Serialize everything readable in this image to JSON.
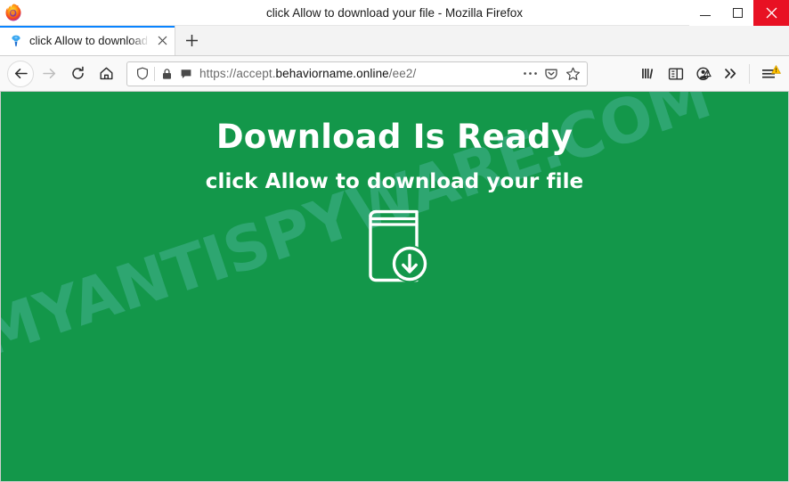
{
  "window": {
    "title": "click Allow to download your file - Mozilla Firefox",
    "app_icon": "firefox-logo-icon",
    "controls": {
      "minimize_label": "Minimize",
      "maximize_label": "Maximize",
      "close_label": "Close",
      "close_bg": "#e81123"
    }
  },
  "tabstrip": {
    "tabs": [
      {
        "title": "click Allow to download your file",
        "favicon": "blue-pin-favicon-icon",
        "active": true,
        "close_label": "×"
      }
    ],
    "new_tab_label": "+",
    "active_indicator_color": "#0a84ff"
  },
  "navbar": {
    "back_label": "Back",
    "forward_label": "Forward",
    "reload_label": "Reload",
    "home_label": "Home",
    "urlbar": {
      "shield_icon": "tracking-protection-shield-icon",
      "lock_icon": "padlock-icon",
      "permission_icon": "permission-notification-icon",
      "url_prefix": "https://accept.",
      "url_host": "behaviorname.online",
      "url_path": "/ee2/",
      "full_url": "https://accept.behaviorname.online/ee2/",
      "page_actions_label": "…",
      "pocket_icon": "pocket-save-icon",
      "bookmark_icon": "star-bookmark-icon"
    },
    "library_label": "Library",
    "sidebar_label": "Sidebars",
    "account_label": "Account",
    "overflow_label": "»",
    "menu_label": "Open menu",
    "menu_badge_color": "#ffbf00"
  },
  "page": {
    "background_color": "#13974a",
    "headline": "Download Is Ready",
    "subheadline": "click Allow to download your file",
    "icon_name": "book-download-icon",
    "watermark": "MYANTISPYWARE.COM",
    "watermark_color": "#78cdd7"
  }
}
